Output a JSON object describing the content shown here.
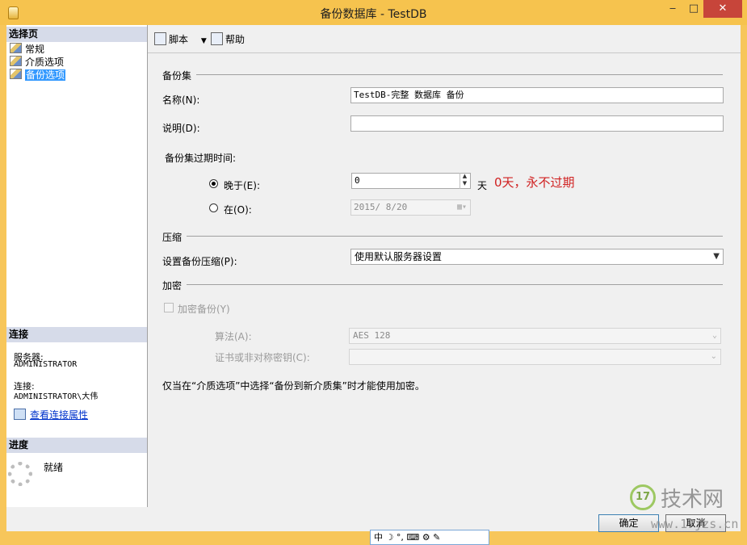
{
  "window": {
    "title": "备份数据库 - TestDB",
    "minimize": "‒",
    "maximize": "□",
    "close": "✕"
  },
  "sidebar": {
    "select_page_header": "选择页",
    "items": [
      {
        "label": "常规"
      },
      {
        "label": "介质选项"
      },
      {
        "label": "备份选项",
        "selected": true
      }
    ],
    "connection_header": "连接",
    "server_label": "服务器:",
    "server_value": "ADMINISTRATOR",
    "connection_label": "连接:",
    "connection_value": "ADMINISTRATOR\\大伟",
    "view_connection_link": "查看连接属性",
    "progress_header": "进度",
    "progress_status": "就绪"
  },
  "toolbar": {
    "script_label": "脚本",
    "help_label": "帮助"
  },
  "backup_set": {
    "group_label": "备份集",
    "name_label": "名称(N):",
    "name_value": "TestDB-完整 数据库 备份",
    "description_label": "说明(D):",
    "description_value": "",
    "expire_label": "备份集过期时间:",
    "after_label": "晚于(E):",
    "after_value": "0",
    "days_unit": "天",
    "on_label": "在(O):",
    "on_value": "2015/ 8/20",
    "annotation": "0天，永不过期"
  },
  "compression": {
    "group_label": "压缩",
    "setting_label": "设置备份压缩(P):",
    "setting_value": "使用默认服务器设置"
  },
  "encryption": {
    "group_label": "加密",
    "encrypt_label": "加密备份(Y)",
    "algorithm_label": "算法(A):",
    "algorithm_value": "AES 128",
    "cert_label": "证书或非对称密钥(C):",
    "cert_value": "",
    "note": "仅当在“介质选项”中选择“备份到新介质集”时才能使用加密。"
  },
  "footer": {
    "ok_label": "确定",
    "cancel_label": "取消"
  },
  "ime": {
    "text": "中 ☽ °, ⌨ ⚙ ✎"
  },
  "watermark": {
    "logo": "17",
    "text": "技术网",
    "url": "www.17jzs.cn"
  },
  "colors": {
    "frame": "#f6c34e",
    "close": "#c7453a",
    "annotation": "#d02020",
    "header": "#d6dbe9"
  }
}
